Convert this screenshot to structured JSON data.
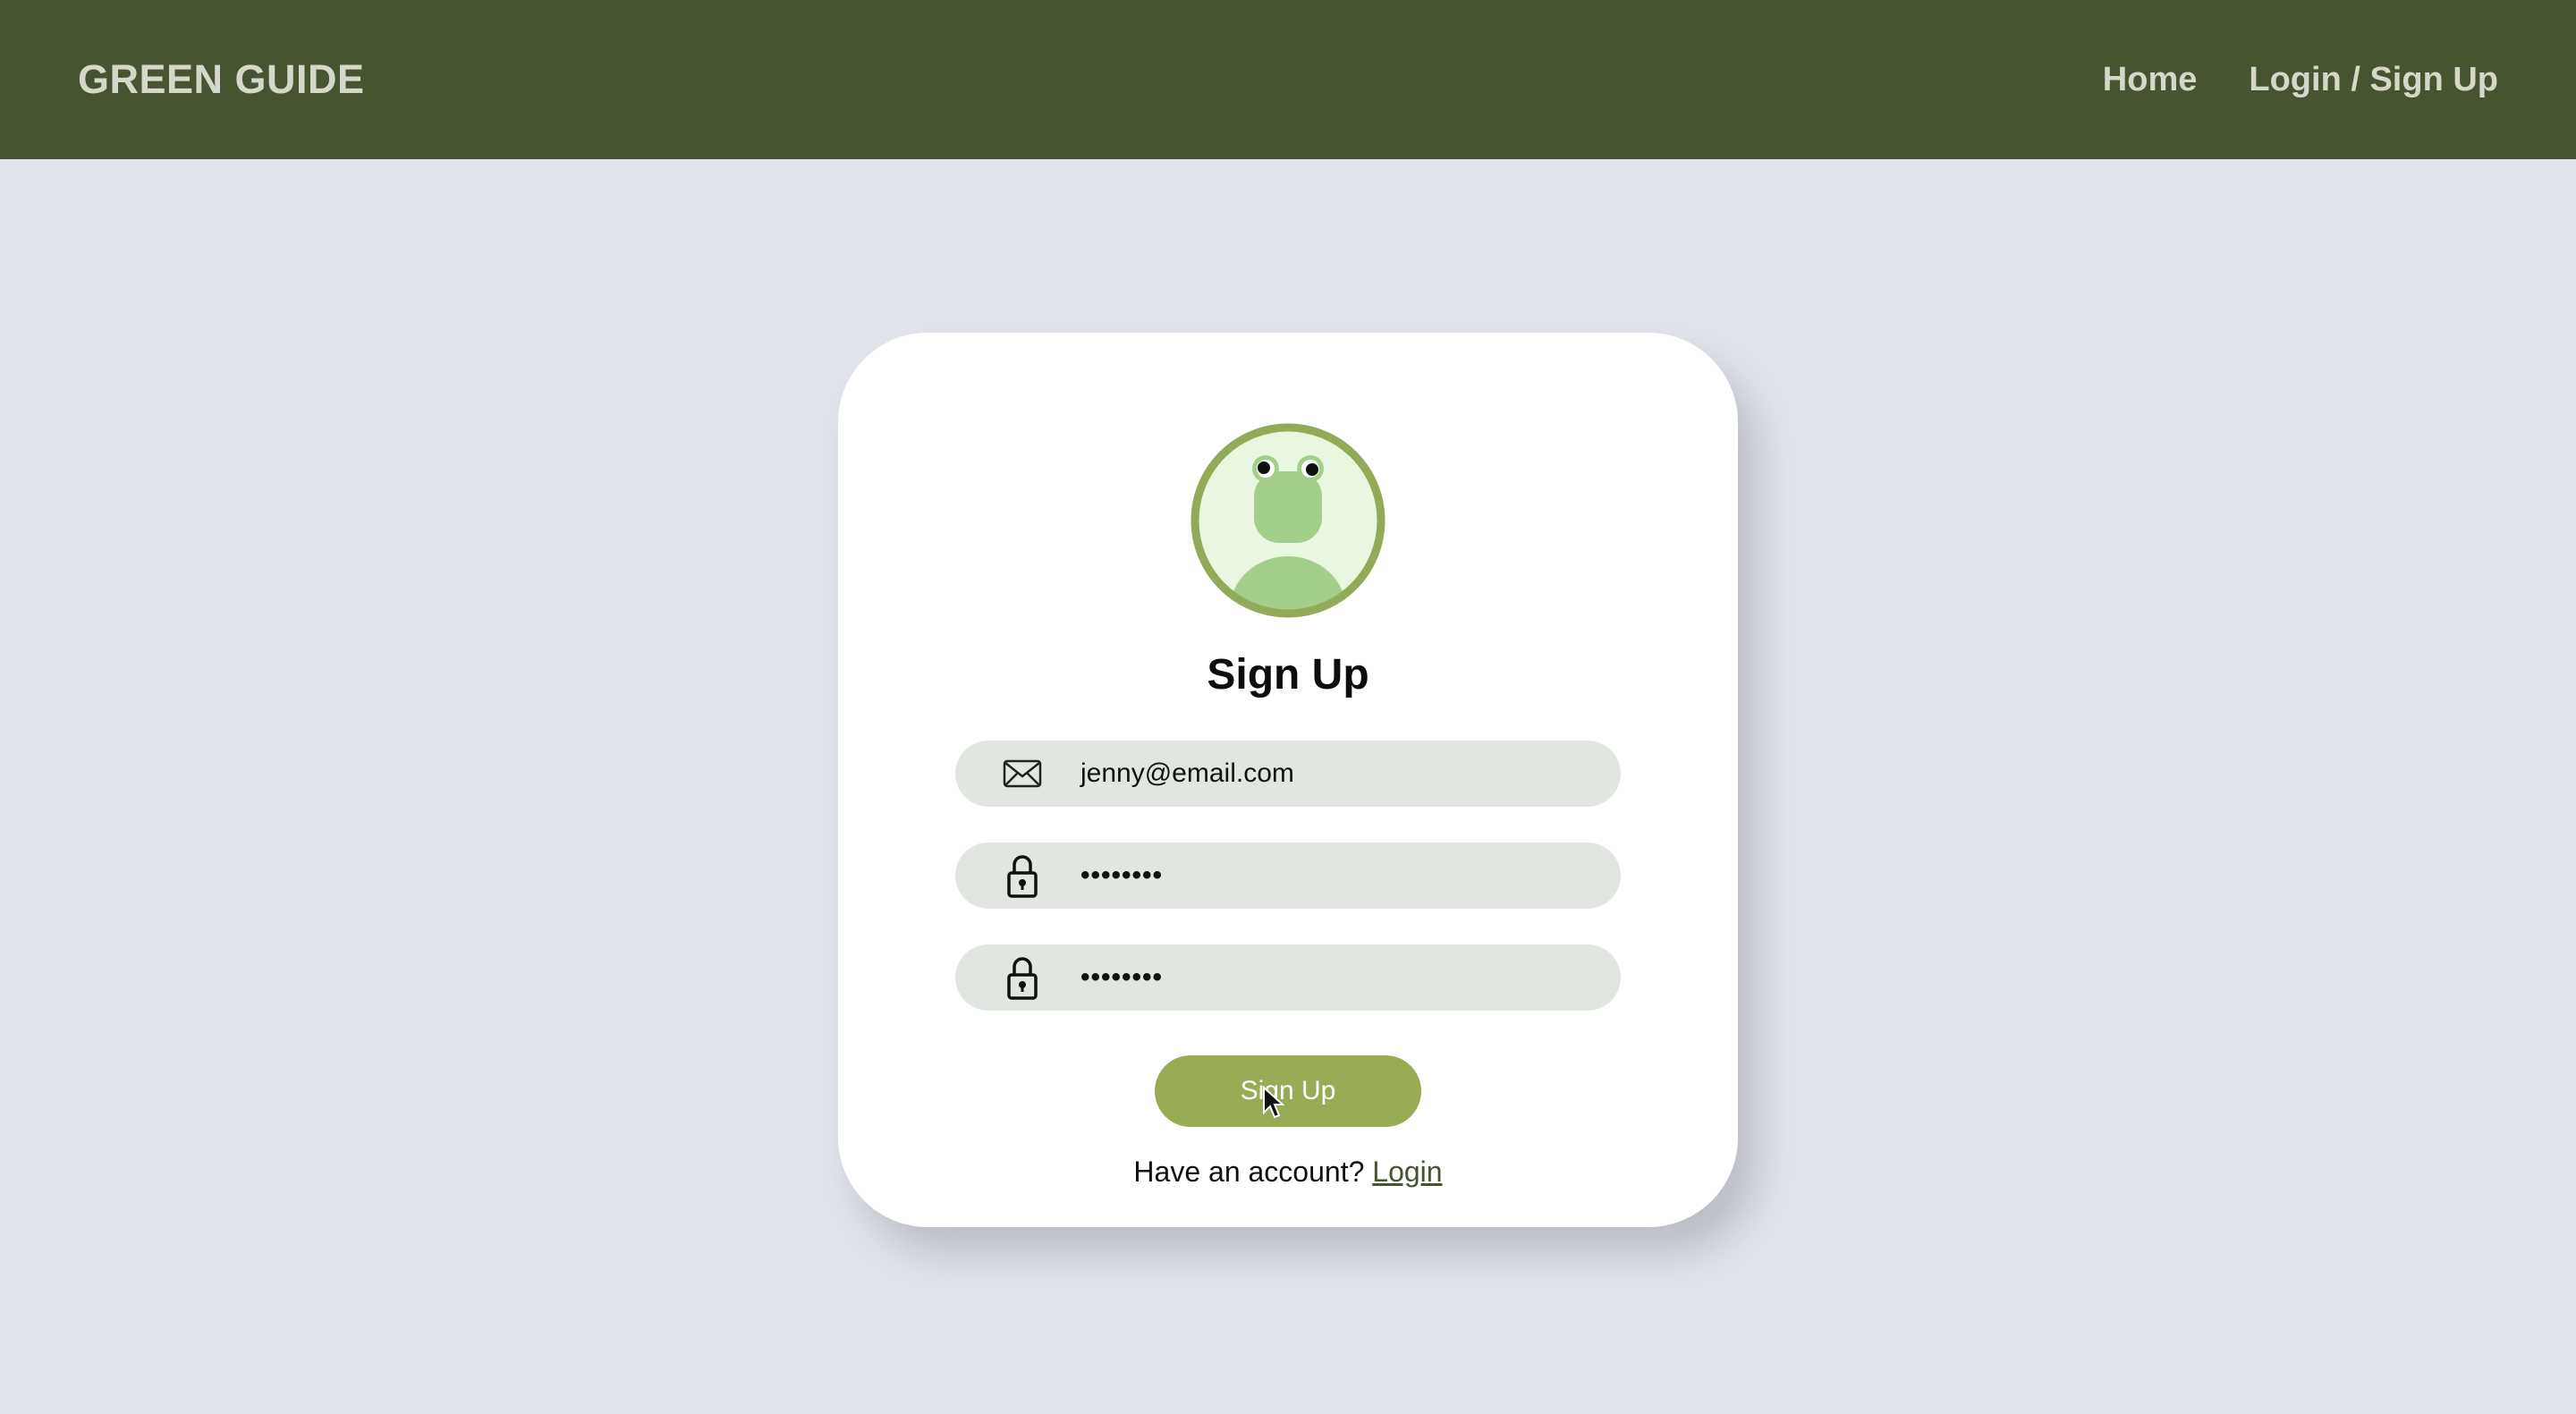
{
  "navbar": {
    "brand": "GREEN GUIDE",
    "links": [
      {
        "label": "Home"
      },
      {
        "label": "Login / Sign Up"
      }
    ],
    "background": "#465432"
  },
  "signup_card": {
    "title": "Sign Up",
    "avatar_icon": "frog-avatar-icon",
    "email_field": {
      "icon": "envelope-icon",
      "value": "jenny@email.com"
    },
    "password_field": {
      "icon": "lock-icon",
      "value": "••••••••"
    },
    "confirm_password_field": {
      "icon": "lock-icon",
      "value": "••••••••"
    },
    "submit_label": "Sign Up",
    "footer_text": "Have an account?",
    "login_link": "Login",
    "accent_color": "#98ab55"
  }
}
